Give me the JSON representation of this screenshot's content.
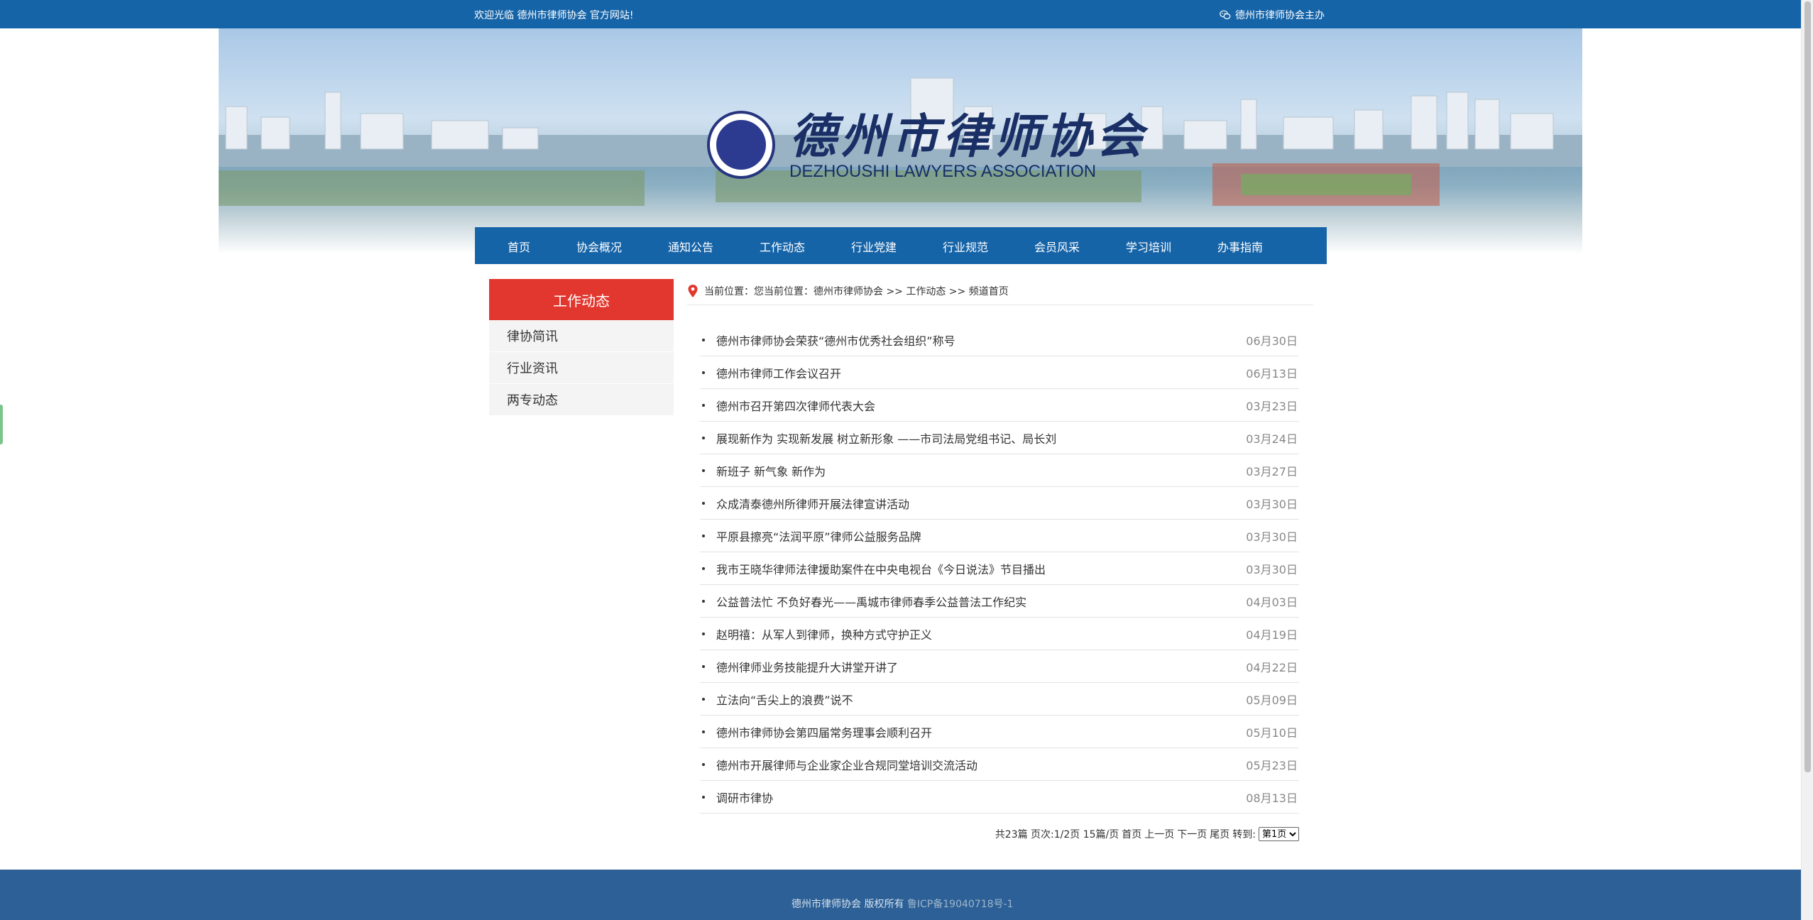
{
  "topbar": {
    "welcome": "欢迎光临 德州市律师协会 官方网站!",
    "host": "德州市律师协会主办"
  },
  "banner": {
    "logo_cn": "德州市律师协会",
    "logo_en": "DEZHOUSHI LAWYERS ASSOCIATION"
  },
  "nav": [
    {
      "label": "首页"
    },
    {
      "label": "协会概况"
    },
    {
      "label": "通知公告"
    },
    {
      "label": "工作动态"
    },
    {
      "label": "行业党建"
    },
    {
      "label": "行业规范"
    },
    {
      "label": "会员风采"
    },
    {
      "label": "学习培训"
    },
    {
      "label": "办事指南"
    }
  ],
  "sidebar": {
    "title": "工作动态",
    "items": [
      {
        "label": "律协简讯"
      },
      {
        "label": "行业资讯"
      },
      {
        "label": "两专动态"
      }
    ]
  },
  "breadcrumb": "当前位置：您当前位置：德州市律师协会 >> 工作动态 >> 频道首页",
  "news": [
    {
      "title": "德州市律师协会荣获“德州市优秀社会组织”称号",
      "date": "06月30日"
    },
    {
      "title": "德州市律师工作会议召开",
      "date": "06月13日"
    },
    {
      "title": "德州市召开第四次律师代表大会",
      "date": "03月23日"
    },
    {
      "title": "展现新作为 实现新发展 树立新形象 ——市司法局党组书记、局长刘",
      "date": "03月24日"
    },
    {
      "title": "新班子 新气象 新作为",
      "date": "03月27日"
    },
    {
      "title": "众成清泰德州所律师开展法律宣讲活动",
      "date": "03月30日"
    },
    {
      "title": "平原县擦亮“法润平原”律师公益服务品牌",
      "date": "03月30日"
    },
    {
      "title": "我市王晓华律师法律援助案件在中央电视台《今日说法》节目播出",
      "date": "03月30日"
    },
    {
      "title": "公益普法忙 不负好春光——禹城市律师春季公益普法工作纪实",
      "date": "04月03日"
    },
    {
      "title": "赵明禧：从军人到律师，换种方式守护正义",
      "date": "04月19日"
    },
    {
      "title": "德州律师业务技能提升大讲堂开讲了",
      "date": "04月22日"
    },
    {
      "title": "立法向“舌尖上的浪费”说不",
      "date": "05月09日"
    },
    {
      "title": "德州市律师协会第四届常务理事会顺利召开",
      "date": "05月10日"
    },
    {
      "title": "德州市开展律师与企业家企业合规同堂培训交流活动",
      "date": "05月23日"
    },
    {
      "title": "调研市律协",
      "date": "08月13日"
    }
  ],
  "pager": {
    "info": "共23篇 页次:1/2页 15篇/页",
    "first": "首页",
    "prev": "上一页",
    "next": "下一页",
    "last": "尾页",
    "goto": "转到:",
    "selected": "第1页"
  },
  "footer": {
    "copyright": "德州市律师协会 版权所有 ",
    "icp": "鲁ICP备19040718号-1"
  }
}
